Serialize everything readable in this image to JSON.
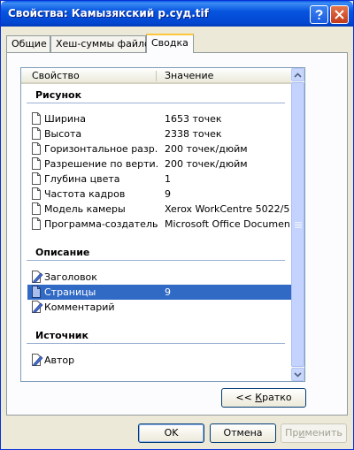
{
  "window": {
    "title": "Свойства: Камызякский р.суд.tif",
    "help_icon": "question-icon",
    "close_icon": "close-icon"
  },
  "tabs": [
    {
      "label": "Общие",
      "active": false
    },
    {
      "label": "Хеш-суммы файлов",
      "active": false
    },
    {
      "label": "Сводка",
      "active": true
    }
  ],
  "list": {
    "columns": {
      "property": "Свойство",
      "value": "Значение"
    },
    "groups": [
      {
        "title": "Рисунок",
        "rows": [
          {
            "label": "Ширина",
            "value": "1653 точек",
            "icon": "document-icon"
          },
          {
            "label": "Высота",
            "value": "2338 точек",
            "icon": "document-icon"
          },
          {
            "label": "Горизонтальное разр...",
            "value": "200 точек/дюйм",
            "icon": "document-icon"
          },
          {
            "label": "Разрешение по верти...",
            "value": "200 точек/дюйм",
            "icon": "document-icon"
          },
          {
            "label": "Глубина цвета",
            "value": "1",
            "icon": "document-icon"
          },
          {
            "label": "Частота кадров",
            "value": "9",
            "icon": "document-icon"
          },
          {
            "label": "Модель камеры",
            "value": "Xerox WorkCentre 5022/5...",
            "icon": "document-icon"
          },
          {
            "label": "Программа-создатель",
            "value": "Microsoft Office Documen...",
            "icon": "document-icon"
          }
        ]
      },
      {
        "title": "Описание",
        "rows": [
          {
            "label": "Заголовок",
            "value": "",
            "icon": "edit-document-icon"
          },
          {
            "label": "Страницы",
            "value": "9",
            "icon": "document-icon",
            "selected": true
          },
          {
            "label": "Комментарий",
            "value": "",
            "icon": "edit-document-icon"
          }
        ]
      },
      {
        "title": "Источник",
        "rows": [
          {
            "label": "Автор",
            "value": "",
            "icon": "edit-document-icon"
          }
        ]
      }
    ]
  },
  "buttons": {
    "short_prefix": "<< ",
    "short_accel": "К",
    "short_rest": "ратко",
    "ok": "OK",
    "cancel": "Отмена",
    "apply_prefix": "Пр",
    "apply_accel": "и",
    "apply_rest": "менить"
  },
  "colors": {
    "titlebar": "#0054e3",
    "selection": "#316ac5",
    "face": "#ece9d8",
    "active_tab_highlight": "#ffc83c"
  }
}
